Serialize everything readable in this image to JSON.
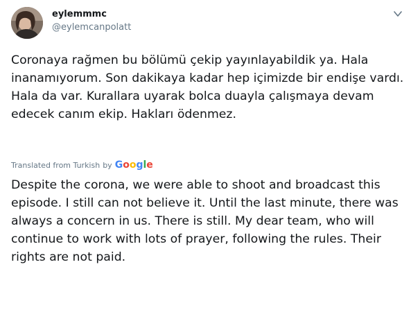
{
  "author": {
    "display_name": "eylemmmc",
    "handle": "@eylemcanpolatt"
  },
  "tweet": {
    "text": "Coronaya rağmen bu bölümü çekip yayınlayabildik ya. Hala inanamıyorum. Son dakikaya kadar hep içimizde bir endişe vardı. Hala da var. Kurallara uyarak bolca duayla çalışmaya devam edecek canım ekip. Hakları ödenmez."
  },
  "translation": {
    "label": "Translated from Turkish",
    "by": "by",
    "provider": "Google",
    "provider_letters": [
      "G",
      "o",
      "o",
      "g",
      "l",
      "e"
    ],
    "text": "Despite the corona, we were able to shoot and broadcast this episode. I still can not believe it. Until the last minute, there was always a concern in us. There is still. My dear team, who will continue to work with lots of prayer, following the rules. Their rights are not paid."
  },
  "icons": {
    "caret": "chevron-down-icon",
    "avatar": "profile-photo"
  },
  "colors": {
    "text": "#14171a",
    "secondary": "#657786",
    "google_blue": "#4285f4",
    "google_red": "#ea4335",
    "google_yellow": "#fbbc05",
    "google_green": "#34a853"
  }
}
